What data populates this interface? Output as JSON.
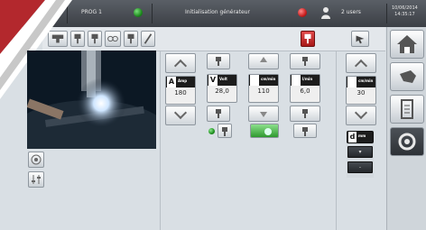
{
  "topbar": {
    "program": "PROG 1",
    "status": "Initialisation générateur",
    "users": "2 users",
    "date": "10/06/2014",
    "time": "14:35:17"
  },
  "params": [
    {
      "letter": "A",
      "unit": "Amp",
      "value": "180"
    },
    {
      "letter": "V",
      "unit": "Volt",
      "value": "28,0"
    },
    {
      "letter": "",
      "unit": "cm/min",
      "value": "110"
    },
    {
      "letter": "",
      "unit": "l/min",
      "value": "6,0"
    },
    {
      "letter": "",
      "unit": "cm/min",
      "value": "30"
    }
  ],
  "panel_d": {
    "letter": "d",
    "unit": "mm"
  },
  "colors": {
    "accent_red": "#c81e1e",
    "led_green": "#1e8a1e"
  }
}
